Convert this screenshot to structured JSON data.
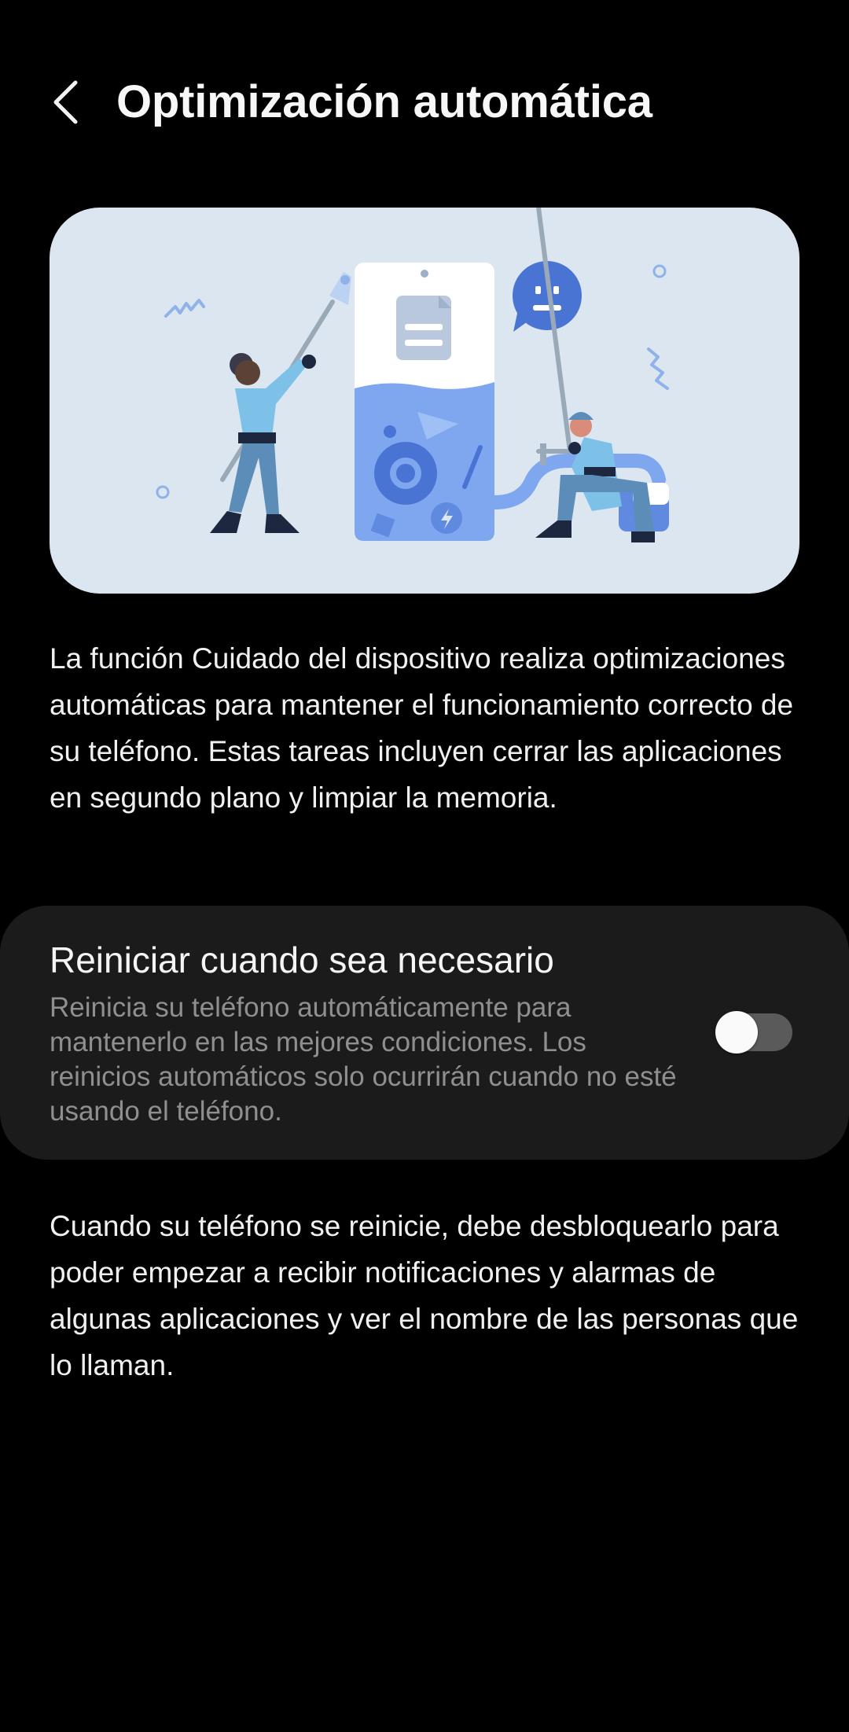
{
  "header": {
    "back_icon": "chevron-left-icon",
    "title": "Optimización automática"
  },
  "illustration": {
    "icon": "device-care-optimization-illustration",
    "background_color": "#dce6f0",
    "accent_color": "#4a74d4"
  },
  "description": "La función Cuidado del dispositivo realiza optimizaciones automáticas para mantener el funcionamiento correcto de su teléfono. Estas tareas incluyen cerrar las aplicaciones en segundo plano y limpiar la memoria.",
  "auto_restart": {
    "title": "Reiniciar cuando sea necesario",
    "description": "Reinicia su teléfono automáticamente para mantenerlo en las mejores condiciones. Los reinicios automáticos solo ocurrirán cuando no esté usando el teléfono.",
    "enabled": false
  },
  "note": "Cuando su teléfono se reinicie, debe desbloquearlo para poder empezar a recibir notificaciones y alarmas de algunas aplicaciones y ver el nombre de las personas que lo llaman.",
  "colors": {
    "background": "#000000",
    "card": "#1b1b1b",
    "toggle_off_track": "#5a5a5a",
    "secondary_text": "#8f8f8f"
  }
}
